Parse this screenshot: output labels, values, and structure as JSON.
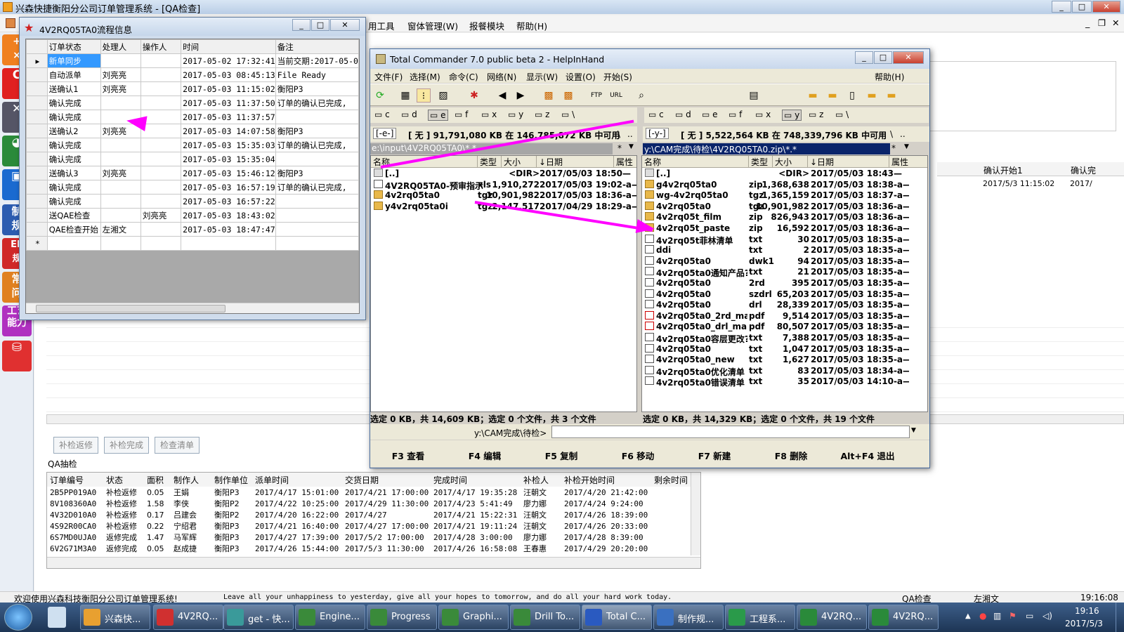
{
  "main_window": {
    "title": "兴森快捷衡阳分公司订单管理系统 - [QA检查]",
    "menu": [
      "用工具",
      "窗体管理(W)",
      "报餐模块",
      "帮助(H)"
    ],
    "left_toolbar": [
      "制\n规",
      "EF\n规",
      "常\n问",
      "工艺\n能力"
    ],
    "right_columns": [
      "确认开始1",
      "确认完"
    ],
    "right_values": [
      "2017/5/3 11:15:02",
      "2017/"
    ]
  },
  "flow_window": {
    "title": "4V2RQ05TA0流程信息",
    "columns": [
      "订单状态",
      "处理人",
      "操作人",
      "时间",
      "备注"
    ],
    "rows": [
      {
        "status": "新单同步",
        "handler": "",
        "operator": "",
        "time": "2017-05-02 17:32:41",
        "note": "当前交期:2017-05-0"
      },
      {
        "status": "自动派单",
        "handler": "刘亮亮",
        "operator": "",
        "time": "2017-05-03 08:45:13",
        "note": "File Ready"
      },
      {
        "status": "送确认1",
        "handler": "刘亮亮",
        "operator": "",
        "time": "2017-05-03 11:15:02",
        "note": "衡阳P3"
      },
      {
        "status": "确认完成",
        "handler": "",
        "operator": "",
        "time": "2017-05-03 11:37:50",
        "note": "订单的确认已完成,"
      },
      {
        "status": "确认完成",
        "handler": "",
        "operator": "",
        "time": "2017-05-03 11:37:57",
        "note": ""
      },
      {
        "status": "送确认2",
        "handler": "刘亮亮",
        "operator": "",
        "time": "2017-05-03 14:07:58",
        "note": "衡阳P3"
      },
      {
        "status": "确认完成",
        "handler": "",
        "operator": "",
        "time": "2017-05-03 15:35:03",
        "note": "订单的确认已完成,"
      },
      {
        "status": "确认完成",
        "handler": "",
        "operator": "",
        "time": "2017-05-03 15:35:04",
        "note": ""
      },
      {
        "status": "送确认3",
        "handler": "刘亮亮",
        "operator": "",
        "time": "2017-05-03 15:46:12",
        "note": "衡阳P3"
      },
      {
        "status": "确认完成",
        "handler": "",
        "operator": "",
        "time": "2017-05-03 16:57:19",
        "note": "订单的确认已完成,"
      },
      {
        "status": "确认完成",
        "handler": "",
        "operator": "",
        "time": "2017-05-03 16:57:22",
        "note": ""
      },
      {
        "status": "送QAE检查",
        "handler": "",
        "operator": "刘亮亮",
        "time": "2017-05-03 18:43:02",
        "note": ""
      },
      {
        "status": "QAE检查开始",
        "handler": "左湘文",
        "operator": "",
        "time": "2017-05-03 18:47:47",
        "note": ""
      }
    ],
    "new_row_marker": "*"
  },
  "tc": {
    "title": "Total Commander 7.0 public beta 2 - HelpInHand",
    "menu": [
      "文件(F)",
      "选择(M)",
      "命令(C)",
      "网络(N)",
      "显示(W)",
      "设置(O)",
      "开始(S)"
    ],
    "help": "帮助(H)",
    "left_drives": [
      "c",
      "d",
      "e",
      "f",
      "x",
      "y",
      "z",
      "\\"
    ],
    "right_drives": [
      "c",
      "d",
      "e",
      "f",
      "x",
      "y",
      "z",
      "\\"
    ],
    "left_drive_sel": "[-e-]",
    "right_drive_sel": "[-y-]",
    "left_free": "[ 无 ]  91,791,080 KB 在 146,785,872 KB 中可用",
    "right_free": "[ 无 ]  5,522,564 KB 在 748,339,796 KB 中可用",
    "left_path": "e:\\input\\4V2RQ05TA0\\*.*",
    "right_path": "y:\\CAM完成\\待检\\4V2RQ05TA0.zip\\*.*",
    "root_btn": "\\",
    "up_btn": "..",
    "star": "*",
    "cols": [
      "名称",
      "类型",
      "大小",
      "↓日期",
      "属性"
    ],
    "left_files": [
      {
        "name": "[..]",
        "ext": "",
        "size": "<DIR>",
        "date": "2017/05/03 18:50—",
        "icon": "up"
      },
      {
        "name": "4V2RQ05TA0-预审指示",
        "ext": "xls",
        "size": "1,910,272",
        "date": "2017/05/03 19:02-a—",
        "icon": "txt"
      },
      {
        "name": "4v2rq05ta0",
        "ext": "tgz",
        "size": "10,901,982",
        "date": "2017/05/03 18:36-a—",
        "icon": "zip"
      },
      {
        "name": "y4v2rq05ta0i",
        "ext": "tgz",
        "size": "2,147,517",
        "date": "2017/04/29 18:29-a—",
        "icon": "zip"
      }
    ],
    "right_files": [
      {
        "name": "[..]",
        "ext": "",
        "size": "<DIR>",
        "date": "2017/05/03 18:43—",
        "icon": "up"
      },
      {
        "name": "g4v2rq05ta0",
        "ext": "zip",
        "size": "1,368,638",
        "date": "2017/05/03 18:38-a—",
        "icon": "zip"
      },
      {
        "name": "wg-4v2rq05ta0",
        "ext": "tgz",
        "size": "1,365,159",
        "date": "2017/05/03 18:37-a—",
        "icon": "zip"
      },
      {
        "name": "4v2rq05ta0",
        "ext": "tgz",
        "size": "10,901,982",
        "date": "2017/05/03 18:36-a—",
        "icon": "zip"
      },
      {
        "name": "4v2rq05t_film",
        "ext": "zip",
        "size": "826,943",
        "date": "2017/05/03 18:36-a—",
        "icon": "zip"
      },
      {
        "name": "4v2rq05t_paste",
        "ext": "zip",
        "size": "16,592",
        "date": "2017/05/03 18:36-a—",
        "icon": "zip"
      },
      {
        "name": "4v2rq05t菲林清单",
        "ext": "txt",
        "size": "30",
        "date": "2017/05/03 18:35-a—",
        "icon": "txt"
      },
      {
        "name": "ddi",
        "ext": "txt",
        "size": "2",
        "date": "2017/05/03 18:35-a—",
        "icon": "txt"
      },
      {
        "name": "4v2rq05ta0",
        "ext": "dwk1",
        "size": "94",
        "date": "2017/05/03 18:35-a—",
        "icon": "txt"
      },
      {
        "name": "4v2rq05ta0通知产品?.",
        "ext": "txt",
        "size": "21",
        "date": "2017/05/03 18:35-a—",
        "icon": "txt"
      },
      {
        "name": "4v2rq05ta0",
        "ext": "2rd",
        "size": "395",
        "date": "2017/05/03 18:35-a—",
        "icon": "txt"
      },
      {
        "name": "4v2rq05ta0",
        "ext": "szdrl",
        "size": "65,203",
        "date": "2017/05/03 18:35-a—",
        "icon": "txt"
      },
      {
        "name": "4v2rq05ta0",
        "ext": "drl",
        "size": "28,339",
        "date": "2017/05/03 18:35-a—",
        "icon": "txt"
      },
      {
        "name": "4v2rq05ta0_2rd_map",
        "ext": "pdf",
        "size": "9,514",
        "date": "2017/05/03 18:35-a—",
        "icon": "pdf"
      },
      {
        "name": "4v2rq05ta0_drl_map",
        "ext": "pdf",
        "size": "80,507",
        "date": "2017/05/03 18:35-a—",
        "icon": "pdf"
      },
      {
        "name": "4v2rq05ta0容层更改?.",
        "ext": "txt",
        "size": "7,388",
        "date": "2017/05/03 18:35-a—",
        "icon": "txt"
      },
      {
        "name": "4v2rq05ta0",
        "ext": "txt",
        "size": "1,047",
        "date": "2017/05/03 18:35-a—",
        "icon": "txt"
      },
      {
        "name": "4v2rq05ta0_new",
        "ext": "txt",
        "size": "1,627",
        "date": "2017/05/03 18:35-a—",
        "icon": "txt"
      },
      {
        "name": "4v2rq05ta0优化清单",
        "ext": "txt",
        "size": "83",
        "date": "2017/05/03 18:34-a—",
        "icon": "txt"
      },
      {
        "name": "4v2rq05ta0错误清单",
        "ext": "txt",
        "size": "35",
        "date": "2017/05/03 14:10-a—",
        "icon": "txt"
      }
    ],
    "left_status": "选定 0 KB，共 14,609 KB；选定 0 个文件，共 3 个文件",
    "right_status": "选定 0 KB，共 14,329 KB；选定 0 个文件，共 19 个文件",
    "cmd_path": "y:\\CAM完成\\待检>",
    "fkeys": [
      "F3 查看",
      "F4 编辑",
      "F5 复制",
      "F6 移动",
      "F7 新建",
      "F8 删除",
      "Alt+F4 退出"
    ]
  },
  "qa": {
    "buttons": [
      "补检返修",
      "补检完成",
      "检查清单"
    ],
    "section_label": "QA抽检",
    "columns": [
      "订单编号",
      "状态",
      "面积",
      "制作人",
      "制作单位",
      "派单时间",
      "交货日期",
      "完成时间",
      "补检人",
      "补检开始时间",
      "剩余时间"
    ],
    "rows": [
      [
        "2B5PP019A0",
        "补检返修",
        "0.05",
        "王娟",
        "衡阳P3",
        "2017/4/17 15:01:00",
        "2017/4/21 17:00:00",
        "2017/4/17 19:35:28",
        "汪朝文",
        "2017/4/20 21:42:00",
        ""
      ],
      [
        "8V108360A0",
        "补检返修",
        "1.58",
        "李侠",
        "衡阳P2",
        "2017/4/22 10:25:00",
        "2017/4/29 11:30:00",
        "2017/4/23 5:41:49",
        "廖力娜",
        "2017/4/24 9:24:00",
        ""
      ],
      [
        "4V32D010A0",
        "补检返修",
        "0.17",
        "吕建会",
        "衡阳P2",
        "2017/4/20 16:22:00",
        "2017/4/27",
        "2017/4/21 15:22:31",
        "汪朝文",
        "2017/4/26 18:39:00",
        ""
      ],
      [
        "4S92R00CA0",
        "补检返修",
        "0.22",
        "宁绍君",
        "衡阳P3",
        "2017/4/21 16:40:00",
        "2017/4/27 17:00:00",
        "2017/4/21 19:11:24",
        "汪朝文",
        "2017/4/26 20:33:00",
        ""
      ],
      [
        "6S7MD0UJA0",
        "返修完成",
        "1.47",
        "马军辉",
        "衡阳P3",
        "2017/4/27 17:39:00",
        "2017/5/2 17:00:00",
        "2017/4/28 3:00:00",
        "廖力娜",
        "2017/4/28 8:39:00",
        ""
      ],
      [
        "6V2G71M3A0",
        "返修完成",
        "0.05",
        "赵成捷",
        "衡阳P3",
        "2017/4/26 15:44:00",
        "2017/5/3 11:30:00",
        "2017/4/26 16:58:08",
        "王春惠",
        "2017/4/29 20:20:00",
        ""
      ]
    ]
  },
  "status": {
    "welcome": "欢迎使用兴森科技衡阳分公司订单管理系统!",
    "quote": "Leave all your unhappiness to yesterday, give all your hopes to tomorrow, and do all your hard work today.",
    "module": "QA检查",
    "user": "左湘文",
    "time": "19:16:08"
  },
  "taskbar": {
    "items": [
      "兴森快...",
      "4V2RQ...",
      "get - 快...",
      "Engine...",
      "Progress",
      "Graphi...",
      "Drill To...",
      "Total C...",
      "制作规...",
      "工程系...",
      "4V2RQ...",
      "4V2RQ..."
    ],
    "clock_time": "19:16",
    "clock_date": "2017/5/3"
  },
  "colors": {
    "arrow": "#ff00ff",
    "selection": "#3399ff",
    "tc_path_active": "#0a246a"
  }
}
